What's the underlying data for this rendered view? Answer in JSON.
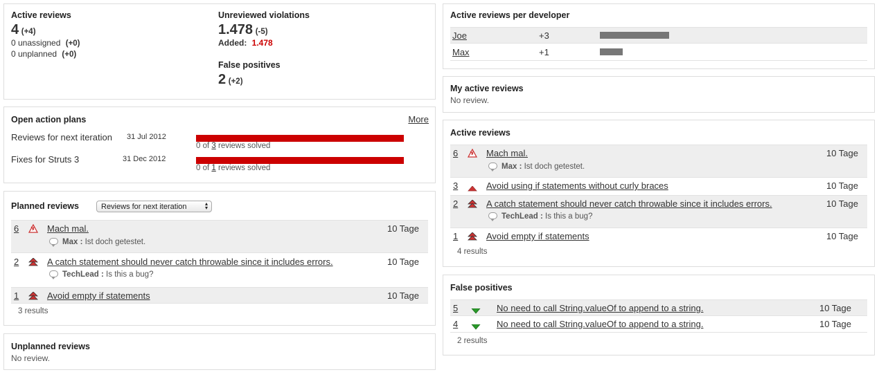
{
  "summary": {
    "active_reviews": {
      "title": "Active reviews",
      "count": "4",
      "delta": "(+4)",
      "unassigned": "0 unassigned",
      "unassigned_delta": "(+0)",
      "unplanned": "0 unplanned",
      "unplanned_delta": "(+0)"
    },
    "unreviewed": {
      "title": "Unreviewed violations",
      "count": "1.478",
      "delta": "(-5)",
      "added_label": "Added:",
      "added_value": "1.478"
    },
    "false_positives": {
      "title": "False positives",
      "count": "2",
      "delta": "(+2)"
    }
  },
  "action_plans": {
    "title": "Open action plans",
    "more": "More",
    "plans": [
      {
        "name": "Reviews for next iteration",
        "date": "31 Jul 2012",
        "pre": "0 of ",
        "count": "3",
        "post": " reviews solved",
        "solved_fraction": 0
      },
      {
        "name": "Fixes for Struts 3",
        "date": "31 Dec 2012",
        "pre": "0 of ",
        "count": "1",
        "post": " reviews solved",
        "solved_fraction": 0
      }
    ]
  },
  "planned": {
    "title": "Planned reviews",
    "select_value": "Reviews for next iteration",
    "rows": [
      {
        "id": "6",
        "icon": "blocker-icon",
        "title": "Mach mal.",
        "age": "10 Tage",
        "comment_author": "Max :",
        "comment_text": " Ist doch getestet."
      },
      {
        "id": "2",
        "icon": "critical-icon",
        "title": "A catch statement should never catch throwable since it includes errors.",
        "age": "10 Tage",
        "comment_author": "TechLead :",
        "comment_text": " Is this a bug?"
      },
      {
        "id": "1",
        "icon": "critical-icon",
        "title": "Avoid empty if statements",
        "age": "10 Tage"
      }
    ],
    "results": "3 results"
  },
  "unplanned": {
    "title": "Unplanned reviews",
    "empty": "No review."
  },
  "per_developer": {
    "title": "Active reviews per developer",
    "devs": [
      {
        "name": "Joe",
        "delta": "+3",
        "value": 3
      },
      {
        "name": "Max",
        "delta": "+1",
        "value": 1
      }
    ]
  },
  "my_reviews": {
    "title": "My active reviews",
    "empty": "No review."
  },
  "active": {
    "title": "Active reviews",
    "rows": [
      {
        "id": "6",
        "icon": "blocker-icon",
        "title": "Mach mal.",
        "age": "10 Tage",
        "comment_author": "Max :",
        "comment_text": " Ist doch getestet."
      },
      {
        "id": "3",
        "icon": "major-icon",
        "title": "Avoid using if statements without curly braces",
        "age": "10 Tage"
      },
      {
        "id": "2",
        "icon": "critical-icon",
        "title": "A catch statement should never catch throwable since it includes errors.",
        "age": "10 Tage",
        "comment_author": "TechLead :",
        "comment_text": " Is this a bug?"
      },
      {
        "id": "1",
        "icon": "critical-icon",
        "title": "Avoid empty if statements",
        "age": "10 Tage"
      }
    ],
    "results": "4 results"
  },
  "false_pos": {
    "title": "False positives",
    "rows": [
      {
        "id": "5",
        "icon": "minor-icon",
        "title": "No need to call String.valueOf to append to a string.",
        "age": "10 Tage"
      },
      {
        "id": "4",
        "icon": "minor-icon",
        "title": "No need to call String.valueOf to append to a string.",
        "age": "10 Tage"
      }
    ],
    "results": "2 results"
  },
  "colors": {
    "accent_red": "#cc0000",
    "bar_grey": "#777777",
    "row_shade": "#eeeeee",
    "minor_green": "#2a9a2a"
  }
}
